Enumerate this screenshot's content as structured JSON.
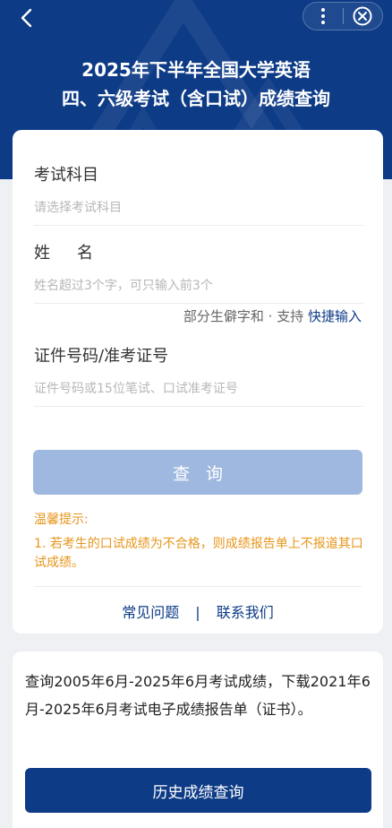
{
  "header": {
    "title_line1": "2025年下半年全国大学英语",
    "title_line2": "四、六级考试（含口试）成绩查询"
  },
  "form": {
    "subject": {
      "label": "考试科目",
      "placeholder": "请选择考试科目"
    },
    "name": {
      "label": "姓名",
      "placeholder": "姓名超过3个字，可只输入前3个"
    },
    "name_hint": {
      "text": "部分生僻字和 · 支持 ",
      "link": "快捷输入"
    },
    "id": {
      "label": "证件号码/准考证号",
      "placeholder": "证件号码或15位笔试、口试准考证号"
    },
    "query_button": "查询"
  },
  "tips": {
    "title": "温馨提示:",
    "items": [
      "1. 若考生的口试成绩为不合格，则成绩报告单上不报道其口试成绩。"
    ]
  },
  "footer_links": {
    "faq": "常见问题",
    "separator": "|",
    "contact": "联系我们"
  },
  "history": {
    "description": "查询2005年6月-2025年6月考试成绩，下载2021年6月-2025年6月考试电子成绩报告单（证书）。",
    "button": "历史成绩查询"
  },
  "icons": {
    "back": "chevron-left-icon",
    "more": "more-vertical-icon",
    "close": "close-circle-icon"
  },
  "colors": {
    "primary": "#0d3b86",
    "button_disabled": "#9eb8df",
    "tip": "#e6961b"
  }
}
